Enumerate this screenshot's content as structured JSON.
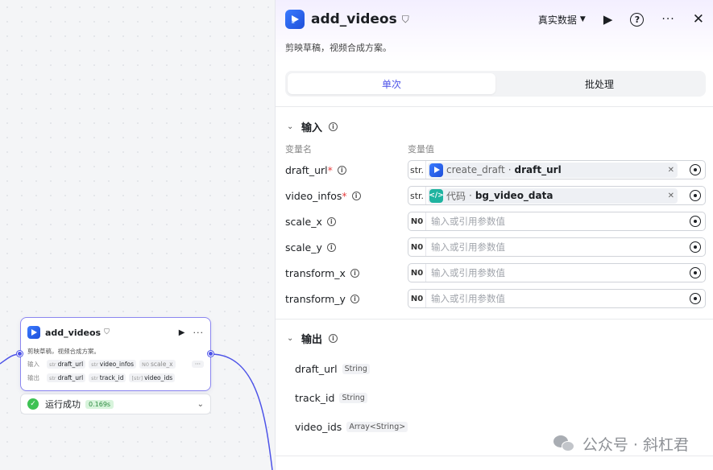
{
  "canvas": {
    "node": {
      "title": "add_videos",
      "store_icon": "store-icon",
      "description": "剪映草稿，视频合成方案。",
      "input_label": "输入",
      "inputs": [
        {
          "type": "str",
          "name": "draft_url"
        },
        {
          "type": "str",
          "name": "video_infos"
        },
        {
          "type": "N0",
          "name": "scale_x"
        }
      ],
      "more": "···",
      "output_label": "输出",
      "outputs": [
        {
          "type": "str",
          "name": "draft_url"
        },
        {
          "type": "str",
          "name": "track_id"
        },
        {
          "type": "[str]",
          "name": "video_ids"
        }
      ]
    },
    "status": {
      "text": "运行成功",
      "time": "0.169s"
    }
  },
  "panel": {
    "title": "add_videos",
    "description": "剪映草稿，视频合成方案。",
    "data_mode": "真实数据",
    "tabs": [
      {
        "label": "单次",
        "active": true
      },
      {
        "label": "批处理",
        "active": false
      }
    ],
    "input_section": {
      "title": "输入",
      "col_name": "变量名",
      "col_value": "变量值",
      "params": [
        {
          "name": "draft_url",
          "required": true,
          "type": "str.",
          "ref": {
            "kind": "plugin",
            "source": "create_draft",
            "var": "draft_url"
          }
        },
        {
          "name": "video_infos",
          "required": true,
          "type": "str.",
          "ref": {
            "kind": "code",
            "source": "代码",
            "var": "bg_video_data"
          }
        },
        {
          "name": "scale_x",
          "required": false,
          "type": "N0",
          "placeholder": "输入或引用参数值"
        },
        {
          "name": "scale_y",
          "required": false,
          "type": "N0",
          "placeholder": "输入或引用参数值"
        },
        {
          "name": "transform_x",
          "required": false,
          "type": "N0",
          "placeholder": "输入或引用参数值"
        },
        {
          "name": "transform_y",
          "required": false,
          "type": "N0",
          "placeholder": "输入或引用参数值"
        }
      ]
    },
    "output_section": {
      "title": "输出",
      "outputs": [
        {
          "name": "draft_url",
          "type": "String"
        },
        {
          "name": "track_id",
          "type": "String"
        },
        {
          "name": "video_ids",
          "type": "Array<String>"
        }
      ]
    }
  },
  "watermark": {
    "text": "公众号 · 斜杠君"
  },
  "colors": {
    "accent": "#4d53e8",
    "node_border": "#8b86f0",
    "success": "#3ec254",
    "required": "#e53e3e",
    "code_logo": "#1fb3a0",
    "plugin_logo": "#2f6bff"
  }
}
